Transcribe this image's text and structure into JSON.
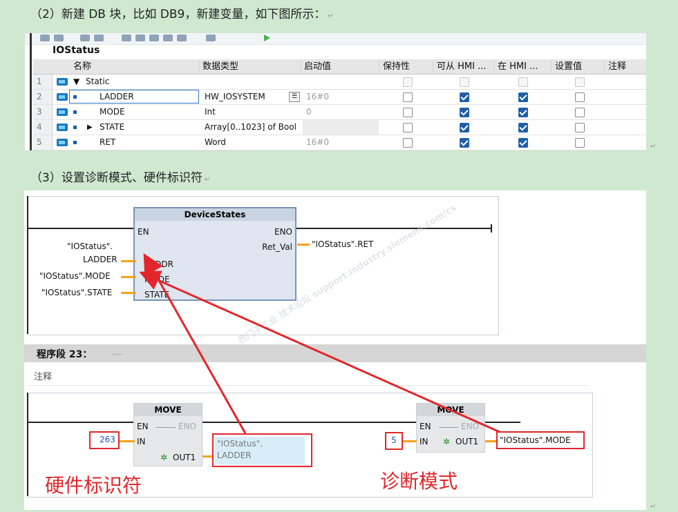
{
  "heading_step2": "（2）新建 DB 块，比如 DB9，新建变量，如下图所示：",
  "heading_step3": "（3）设置诊断模式、硬件标识符",
  "db_block_name": "IOStatus",
  "db_columns": [
    "名称",
    "数据类型",
    "启动值",
    "保持性",
    "可从 HMI ...",
    "在 HMI ...",
    "设置值",
    "注释"
  ],
  "db_rows": [
    {
      "num": "1",
      "name": "Static",
      "type": "",
      "start": ""
    },
    {
      "num": "2",
      "name": "LADDER",
      "type": "HW_IOSYSTEM",
      "start": "16#0"
    },
    {
      "num": "3",
      "name": "MODE",
      "type": "Int",
      "start": "0"
    },
    {
      "num": "4",
      "name": "STATE",
      "type": "Array[0..1023] of Bool",
      "start": ""
    },
    {
      "num": "5",
      "name": "RET",
      "type": "Word",
      "start": "16#0"
    }
  ],
  "ladder": {
    "block_title": "DeviceStates",
    "en": "EN",
    "eno": "ENO",
    "ret_val": "Ret_Val",
    "ret_operand": "\"IOStatus\".RET",
    "laddr_pin": "LADDR",
    "mode_pin": "MODE",
    "state_pin": "STATE",
    "laddr_operand_line1": "\"IOStatus\".",
    "laddr_operand_line2": "LADDER",
    "mode_operand": "\"IOStatus\".MODE",
    "state_operand": "\"IOStatus\".STATE",
    "segment_title": "程序段 23：",
    "segment_dots": ".....",
    "comment_label": "注释",
    "move_title": "MOVE",
    "in_pin": "IN",
    "out1_pin": "OUT1",
    "move1_in_value": "263",
    "move1_out_line1": "\"IOStatus\".",
    "move1_out_line2": "LADDER",
    "move2_in_value": "5",
    "move2_out_value": "\"IOStatus\".MODE",
    "label_hw_id": "硬件标识符",
    "label_diag_mode": "诊断模式",
    "watermark": "西门子工业 技术论坛 support.industry.siemens.com/cs"
  },
  "colors": {
    "accent_red": "#e2262b",
    "wire_orange": "#f6a11a",
    "page_bg": "#cfe8cf"
  }
}
